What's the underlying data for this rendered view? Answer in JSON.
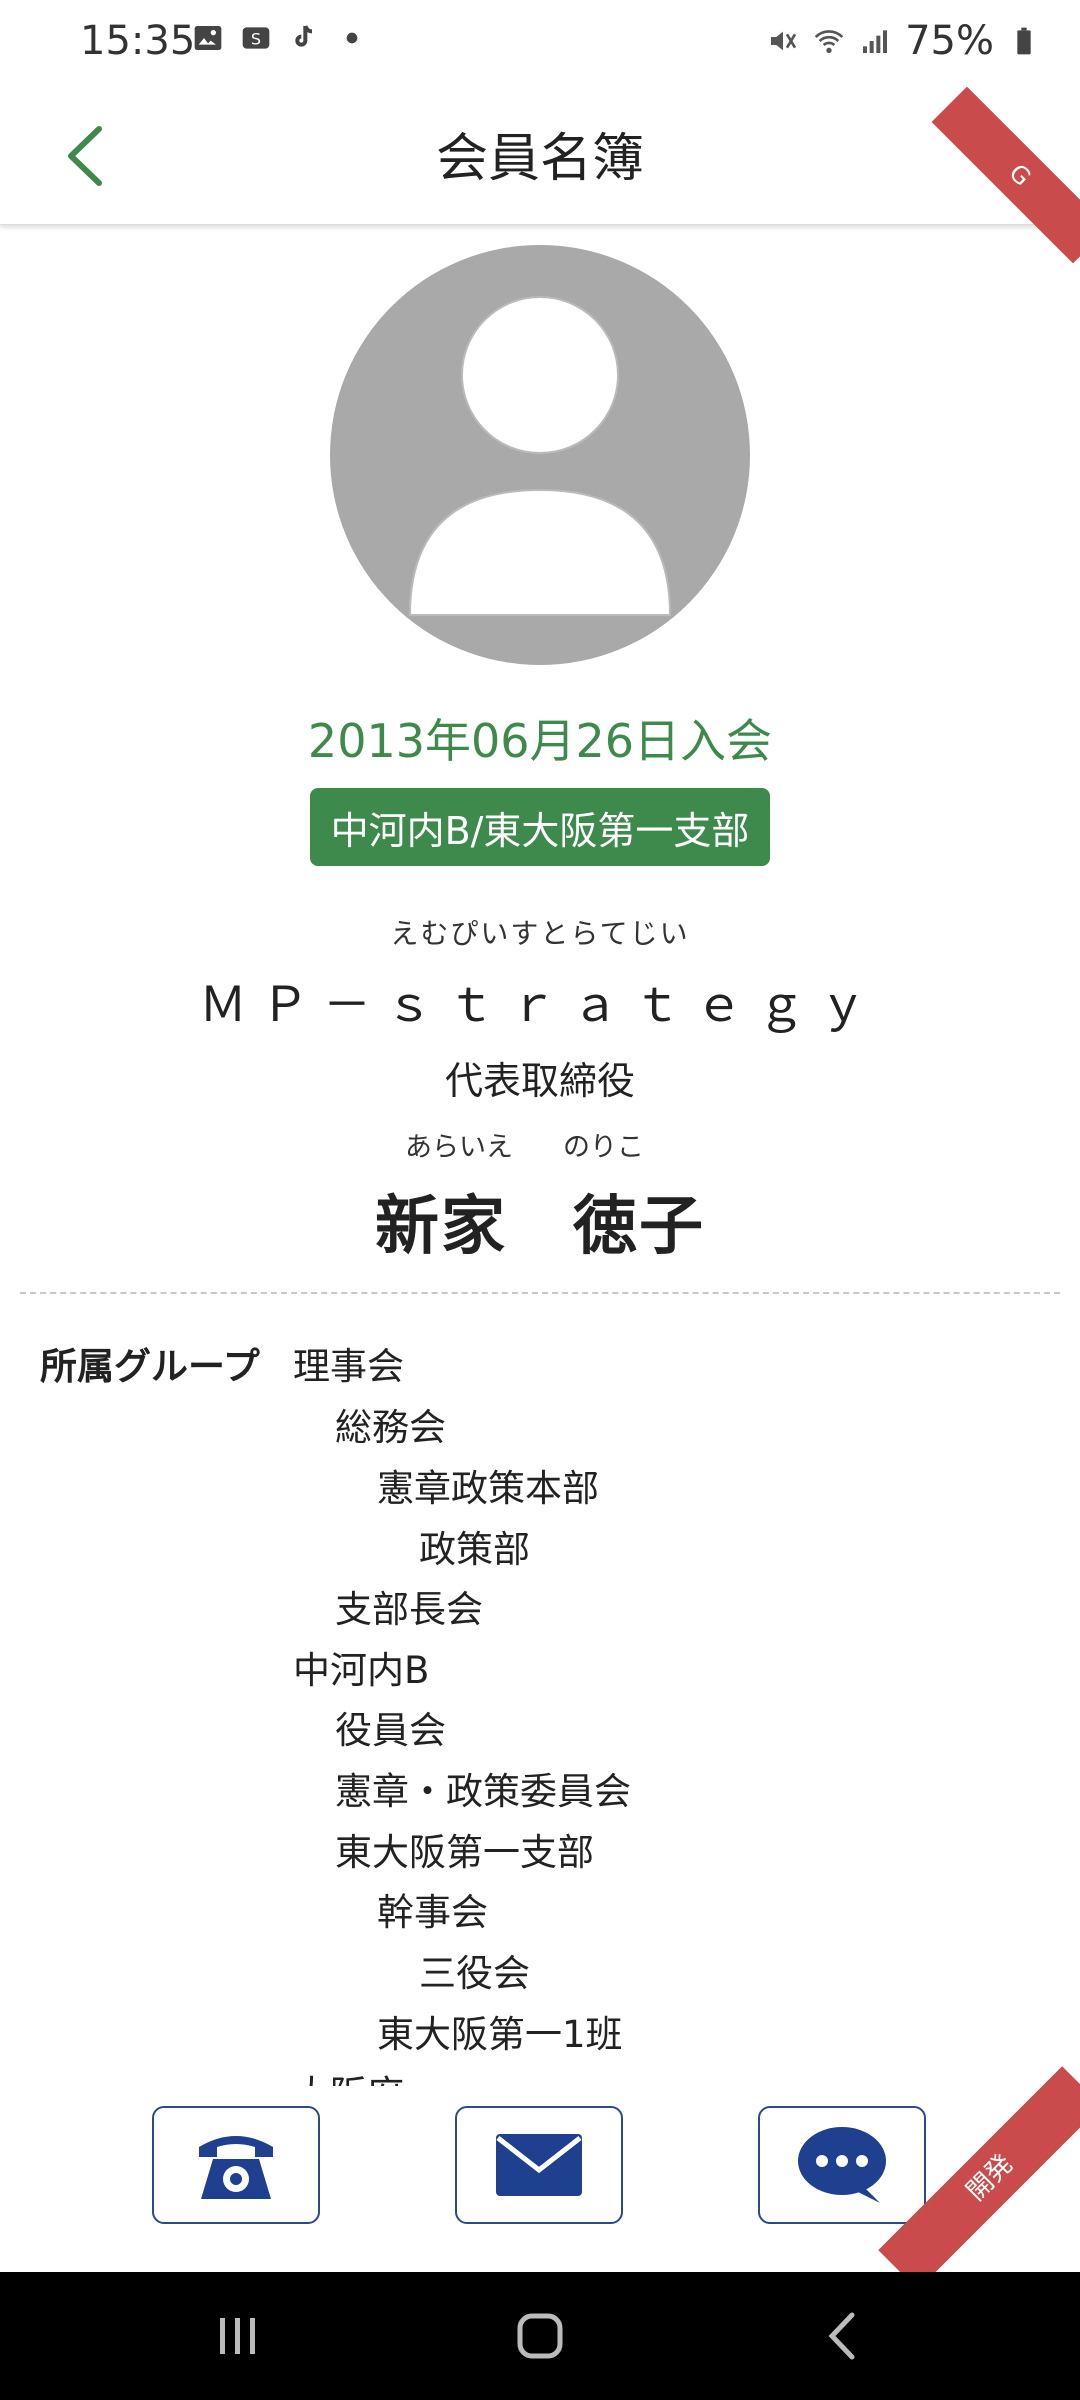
{
  "status_bar": {
    "time": "15:35",
    "battery_text": "75%",
    "icons_left": [
      "image-icon",
      "s-app-icon",
      "tiktok-icon",
      "dot-icon"
    ],
    "icons_right": [
      "mute-icon",
      "wifi-icon",
      "signal-icon",
      "battery-icon"
    ]
  },
  "header": {
    "title": "会員名簿",
    "back_icon": "chevron-left-icon",
    "ribbon_text": "G"
  },
  "profile": {
    "avatar_icon": "person-placeholder-icon",
    "join_date": "2013年06月26日入会",
    "branch": "中河内B/東大阪第一支部",
    "company_ruby": "えむぴいすとらてじい",
    "company_name": "ＭＰ－ｓｔｒａｔｅｇｙ",
    "company_role": "代表取締役",
    "name_ruby_family": "あらいえ",
    "name_ruby_given": "のりこ",
    "name": "新家　徳子"
  },
  "groups": {
    "label": "所属グループ",
    "items": [
      {
        "text": "理事会",
        "level": 0
      },
      {
        "text": "総務会",
        "level": 1
      },
      {
        "text": "憲章政策本部",
        "level": 2
      },
      {
        "text": "政策部",
        "level": 3
      },
      {
        "text": "支部長会",
        "level": 1
      },
      {
        "text": "中河内B",
        "level": 0
      },
      {
        "text": "役員会",
        "level": 1
      },
      {
        "text": "憲章・政策委員会",
        "level": 1
      },
      {
        "text": "東大阪第一支部",
        "level": 1
      },
      {
        "text": "幹事会",
        "level": 2
      },
      {
        "text": "三役会",
        "level": 3
      },
      {
        "text": "東大阪第一1班",
        "level": 2
      },
      {
        "text": "大阪府",
        "level": 0
      }
    ]
  },
  "actions": {
    "phone_icon": "telephone-icon",
    "mail_icon": "mail-icon",
    "chat_icon": "chat-bubble-icon",
    "ribbon_text": "開発"
  },
  "colors": {
    "accent_green": "#3e8a4d",
    "button_blue": "#1f3f8f",
    "ribbon_red": "#c94b4b"
  }
}
